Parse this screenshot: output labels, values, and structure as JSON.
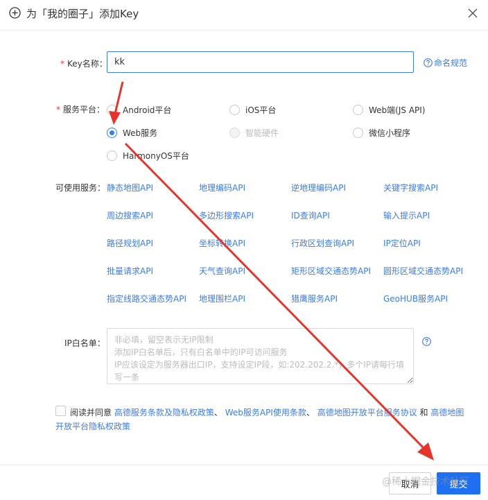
{
  "header": {
    "title": "为「我的圈子」添加Key"
  },
  "form": {
    "key_name": {
      "label": "Key名称：",
      "value": "kk"
    },
    "naming_link": "命名规范",
    "platform": {
      "label": "服务平台：",
      "options": [
        {
          "label": "Android平台",
          "state": "default"
        },
        {
          "label": "iOS平台",
          "state": "default"
        },
        {
          "label": "Web端(JS API)",
          "state": "default"
        },
        {
          "label": "Web服务",
          "state": "checked"
        },
        {
          "label": "智能硬件",
          "state": "disabled"
        },
        {
          "label": "微信小程序",
          "state": "default"
        },
        {
          "label": "HarmonyOS平台",
          "state": "default"
        }
      ]
    },
    "services": {
      "label": "可使用服务：",
      "items": [
        "静态地图API",
        "地理编码API",
        "逆地理编码API",
        "关键字搜索API",
        "周边搜索API",
        "多边形搜索API",
        "ID查询API",
        "输入提示API",
        "路径规划API",
        "坐标转换API",
        "行政区划查询API",
        "IP定位API",
        "批量请求API",
        "天气查询API",
        "矩形区域交通态势API",
        "圆形区域交通态势API",
        "指定线路交通态势API",
        "地理围栏API",
        "猎鹰服务API",
        "GeoHUB服务API"
      ]
    },
    "ip_whitelist": {
      "label": "IP白名单：",
      "placeholder": "非必填，留空表示无IP限制\n添加IP白名单后，只有白名单中的IP可访问服务\nIP应该设定为服务器出口IP，支持设定IP段，如:202.202.2.*，多个IP请每行填写一条"
    },
    "agreement": {
      "prefix": "阅读并同意",
      "link1": "高德服务条款及隐私权政策",
      "sep1": "、",
      "link2": "Web服务API使用条款",
      "sep2": "、",
      "link3": "高德地图开放平台服务协议",
      "conj": "和",
      "link4": "高德地图开放平台隐私权政策"
    }
  },
  "footer": {
    "cancel_label": "取消",
    "submit_label": "提交"
  },
  "watermark": "@稀土掘金技术社区",
  "colors": {
    "accent": "#3b7bea",
    "primary_button": "#1e6ff1",
    "required": "#e4393c",
    "annotation_arrow": "#e8332a"
  }
}
